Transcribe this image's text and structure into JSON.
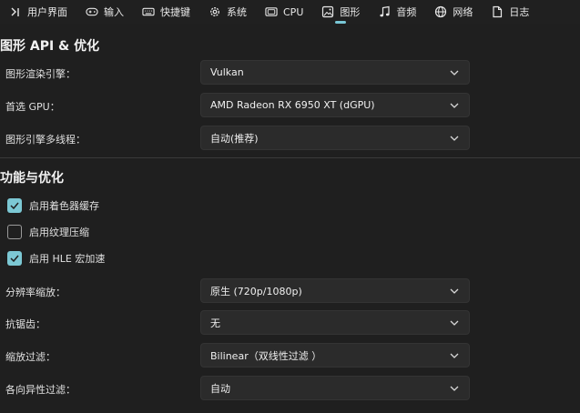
{
  "tabs": [
    {
      "label": "用户界面",
      "icon": "user-interface-icon"
    },
    {
      "label": "输入",
      "icon": "gamepad-icon"
    },
    {
      "label": "快捷键",
      "icon": "keyboard-icon"
    },
    {
      "label": "系统",
      "icon": "gear-icon"
    },
    {
      "label": "CPU",
      "icon": "cpu-icon"
    },
    {
      "label": "图形",
      "icon": "image-icon"
    },
    {
      "label": "音频",
      "icon": "music-note-icon"
    },
    {
      "label": "网络",
      "icon": "globe-icon"
    },
    {
      "label": "日志",
      "icon": "document-icon"
    }
  ],
  "active_tab": "图形",
  "graphics_section": {
    "title": "图形 API & 优化",
    "rows": [
      {
        "label": "图形渲染引擎：",
        "value": "Vulkan"
      },
      {
        "label": "首选 GPU：",
        "value": "AMD Radeon RX 6950 XT (dGPU)"
      },
      {
        "label": "图形引擎多线程：",
        "value": "自动(推荐)"
      }
    ]
  },
  "features_section": {
    "title": "功能与优化",
    "checkboxes": [
      {
        "label": "启用着色器缓存",
        "checked": true
      },
      {
        "label": "启用纹理压缩",
        "checked": false
      },
      {
        "label": "启用 HLE 宏加速",
        "checked": true
      }
    ],
    "rows": [
      {
        "label": "分辨率缩放：",
        "value": "原生 (720p/1080p)"
      },
      {
        "label": "抗锯齿：",
        "value": "无"
      },
      {
        "label": "缩放过滤：",
        "value": "Bilinear（双线性过滤 ）"
      },
      {
        "label": "各向异性过滤：",
        "value": "自动"
      }
    ]
  },
  "colors": {
    "accent": "#7cc8d4",
    "background": "#1f1f1f",
    "field": "#2b2b2b"
  }
}
